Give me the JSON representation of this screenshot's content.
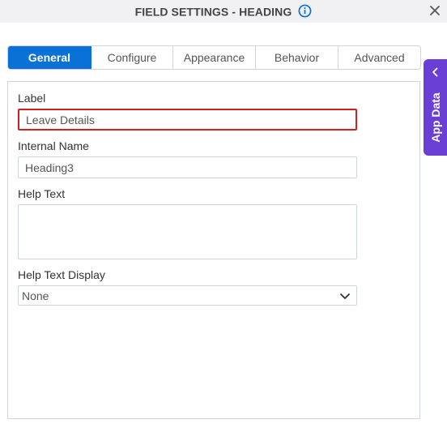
{
  "header": {
    "title": "FIELD SETTINGS - HEADING",
    "info_icon": "info-icon",
    "close_icon": "close-icon"
  },
  "tabs": [
    {
      "label": "General",
      "active": true
    },
    {
      "label": "Configure",
      "active": false
    },
    {
      "label": "Appearance",
      "active": false
    },
    {
      "label": "Behavior",
      "active": false
    },
    {
      "label": "Advanced",
      "active": false
    }
  ],
  "form": {
    "label_field": {
      "label": "Label",
      "value": "Leave Details",
      "state": "error"
    },
    "internal_name": {
      "label": "Internal Name",
      "value": "Heading3"
    },
    "help_text": {
      "label": "Help Text",
      "value": ""
    },
    "help_text_display": {
      "label": "Help Text Display",
      "selected": "None"
    }
  },
  "side_panel": {
    "label": "App Data",
    "icon": "chevron-left-icon"
  },
  "colors": {
    "accent": "#0a72d6",
    "error": "#d21f1f",
    "app_data": "#6a3fd6"
  }
}
